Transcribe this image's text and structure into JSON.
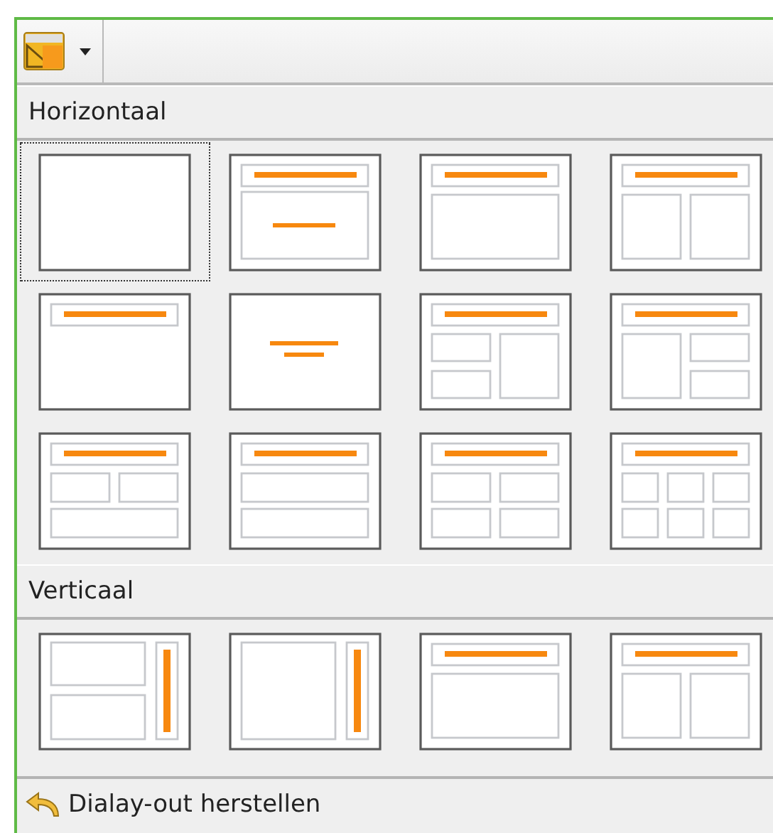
{
  "sections": [
    {
      "title": "Horizontaal",
      "layouts": [
        {
          "kind": "blank",
          "selected": true
        },
        {
          "kind": "title-subtitle",
          "selected": false
        },
        {
          "kind": "title-content",
          "selected": false
        },
        {
          "kind": "title-two-columns",
          "selected": false
        },
        {
          "kind": "title-only",
          "selected": false
        },
        {
          "kind": "centered-text",
          "selected": false
        },
        {
          "kind": "title-left-stacked",
          "selected": false
        },
        {
          "kind": "title-right-stacked",
          "selected": false
        },
        {
          "kind": "title-two-over-one",
          "selected": false
        },
        {
          "kind": "title-two-rows",
          "selected": false
        },
        {
          "kind": "title-grid-four",
          "selected": false
        },
        {
          "kind": "title-grid-six",
          "selected": false
        }
      ]
    },
    {
      "title": "Verticaal",
      "layouts": [
        {
          "kind": "vertical-two-stacked",
          "selected": false
        },
        {
          "kind": "vertical-content",
          "selected": false
        },
        {
          "kind": "title-content",
          "selected": false
        },
        {
          "kind": "title-two-columns",
          "selected": false
        }
      ]
    }
  ],
  "footer": {
    "label": "Dialay-out herstellen"
  }
}
